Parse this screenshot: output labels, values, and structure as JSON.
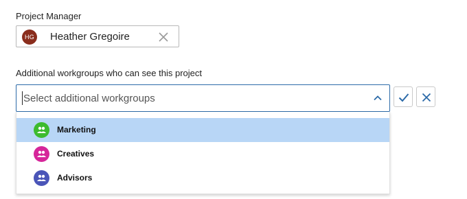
{
  "project_manager": {
    "label": "Project Manager",
    "initials": "HG",
    "name": "Heather Gregoire",
    "avatar_color": "#8a2d1d"
  },
  "workgroups": {
    "label": "Additional workgroups who can see this project",
    "placeholder": "Select additional workgroups",
    "border_color": "#2b6aa8",
    "options": [
      {
        "label": "Marketing",
        "icon": "group-icon",
        "color": "#3dbb2f",
        "highlighted": true
      },
      {
        "label": "Creatives",
        "icon": "group-icon",
        "color": "#d6269a",
        "highlighted": false
      },
      {
        "label": "Advisors",
        "icon": "group-icon",
        "color": "#4a55b8",
        "highlighted": false
      }
    ]
  },
  "actions": {
    "confirm_icon": "check-icon",
    "cancel_icon": "close-icon",
    "accent": "#2b6aa8"
  }
}
